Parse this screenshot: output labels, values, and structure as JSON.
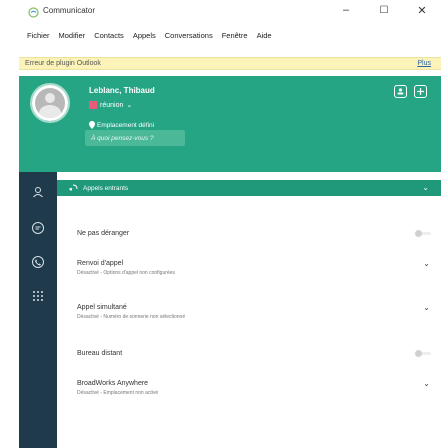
{
  "window": {
    "title": "Communicator",
    "minimize": "–",
    "maximize": "☐",
    "close": "✕"
  },
  "menu": [
    "Fichier",
    "Modifier",
    "Contacts",
    "Appels",
    "Conversations",
    "Fenêtre",
    "Aide"
  ],
  "plugin_bar": {
    "text": "Erreur de plugin Outlook",
    "more": "Plus"
  },
  "user": {
    "name": "Leblanc, Thibaud",
    "status": "réunion",
    "status_color": "#e95d7a",
    "location": "Emplacement défini",
    "thinking_placeholder": "À quoi pensez-vous ?"
  },
  "calls_bar": {
    "label": "Appels entrants"
  },
  "settings": [
    {
      "title": "Ne pas déranger",
      "subtitle": "",
      "control": "toggle",
      "on": false
    },
    {
      "title": "Renvoi d'appel",
      "subtitle": "Désactivé - Options d'appel non configurées",
      "control": "chevron"
    },
    {
      "title": "Appel simultané",
      "subtitle": "Désactivé - Numéro de sonnerie non sélectionné",
      "control": "chevron"
    },
    {
      "title": "Bureau distant",
      "subtitle": "",
      "control": "toggle",
      "on": false
    },
    {
      "title": "BroadWorks Anywhere",
      "subtitle": "Désactivé - Emplacement non activé",
      "control": "chevron"
    }
  ],
  "colors": {
    "accent": "#25a584",
    "sidebar": "#1f3a4b",
    "plugin_bar": "#fbf3b7"
  },
  "icons": {
    "app": "communicator-icon",
    "sidebar": [
      "contacts-icon",
      "chat-icon",
      "phone-icon",
      "dialpad-icon"
    ]
  }
}
